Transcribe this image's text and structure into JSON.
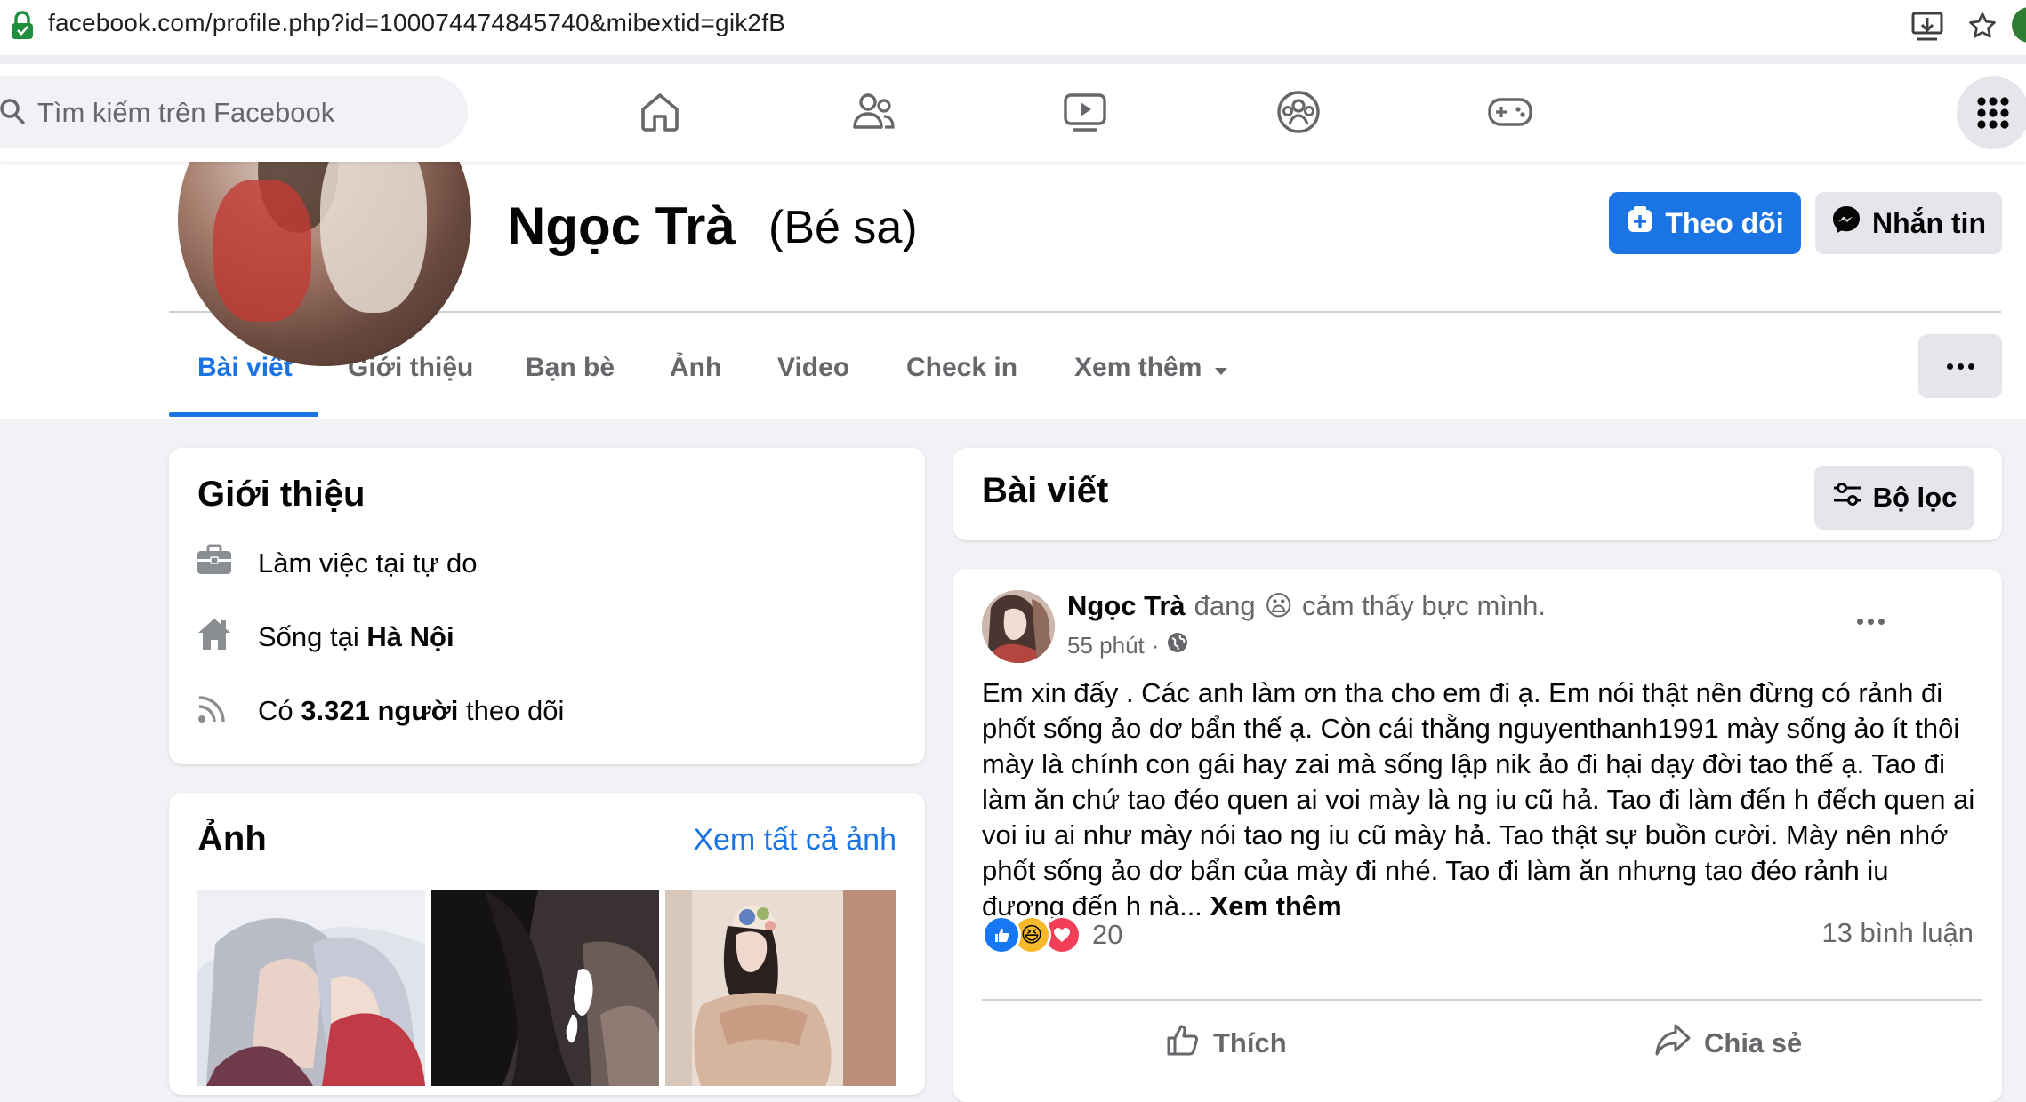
{
  "browser": {
    "url": "facebook.com/profile.php?id=100074474845740&mibextid=gik2fB"
  },
  "nav": {
    "search_placeholder": "Tìm kiếm trên Facebook"
  },
  "profile": {
    "name": "Ngọc Trà",
    "alternate_name": "(Bé sa)",
    "follow_label": "Theo dõi",
    "message_label": "Nhắn tin"
  },
  "tabs": [
    {
      "label": "Bài viết",
      "active": true
    },
    {
      "label": "Giới thiệu"
    },
    {
      "label": "Bạn bè"
    },
    {
      "label": "Ảnh"
    },
    {
      "label": "Video"
    },
    {
      "label": "Check in"
    },
    {
      "label": "Xem thêm"
    }
  ],
  "intro": {
    "title": "Giới thiệu",
    "work_prefix": "Làm việc tại tự do",
    "lives_prefix": "Sống tại ",
    "lives_city": "Hà Nội",
    "followers_prefix": "Có ",
    "followers_count": "3.321 người",
    "followers_suffix": " theo dõi"
  },
  "photos": {
    "title": "Ảnh",
    "see_all": "Xem tất cả ảnh"
  },
  "posts_header": {
    "title": "Bài viết",
    "filter_label": "Bộ lọc"
  },
  "post": {
    "author": "Ngọc Trà",
    "feeling_prefix": "đang",
    "feeling_emoji": "😦",
    "feeling_text": "cảm thấy bực mình.",
    "time": "55 phút",
    "separator": "·",
    "body": "Em xin đấy . Các anh làm ơn tha cho em đi ạ. Em nói thật nên đừng có rảnh đi phốt sống ảo dơ bẩn thế ạ. Còn cái thằng nguyenthanh1991 mày sống ảo ít thôi mày là chính con gái hay zai mà sống lập nik ảo đi hại dạy đời tao thế ạ. Tao đi làm ăn chứ tao đéo quen ai voi mày là ng iu cũ hả. Tao đi làm đến h đếch quen ai voi iu ai như mày nói tao ng iu cũ mày hả. Tao thật sự buồn cười. Mày nên nhớ phốt sống ảo dơ bẩn của mày đi nhé. Tao đi làm ăn nhưng tao đéo rảnh iu đương đến h nà... ",
    "see_more": "Xem thêm",
    "reaction_count": "20",
    "reaction_emoji_haha": "😆",
    "comments": "13 bình luận",
    "like_label": "Thích",
    "share_label": "Chia sẻ"
  },
  "colors": {
    "accent": "#1b74e4",
    "background": "#f0f2f5",
    "secondary_text": "#65676b"
  }
}
